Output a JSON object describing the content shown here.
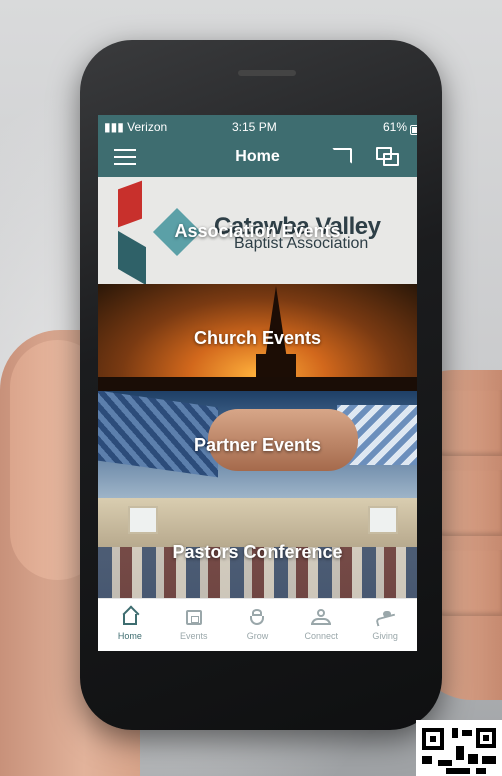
{
  "status_bar": {
    "carrier": "▮▮▮ Verizon",
    "wifi_icon": "wifi-icon",
    "time": "3:15 PM",
    "battery": "61%"
  },
  "header": {
    "title": "Home",
    "menu_icon": "hamburger-menu-icon",
    "cast_icon": "cast-icon",
    "chat_icon": "chat-icon"
  },
  "logo": {
    "line1": "Catawba Valley",
    "line2": "Baptist Association"
  },
  "tiles": [
    {
      "label": "Association Events"
    },
    {
      "label": "Church Events"
    },
    {
      "label": "Partner Events"
    },
    {
      "label": "Pastors Conference"
    }
  ],
  "tabbar": {
    "items": [
      {
        "label": "Home",
        "icon": "home-icon",
        "active": true
      },
      {
        "label": "Events",
        "icon": "calendar-icon",
        "active": false
      },
      {
        "label": "Grow",
        "icon": "plant-icon",
        "active": false
      },
      {
        "label": "Connect",
        "icon": "people-icon",
        "active": false
      },
      {
        "label": "Giving",
        "icon": "giving-hand-icon",
        "active": false
      }
    ]
  },
  "colors": {
    "header_bg": "#3e6d70",
    "tab_active": "#3e6d70",
    "tab_inactive": "#9aa7aa"
  }
}
